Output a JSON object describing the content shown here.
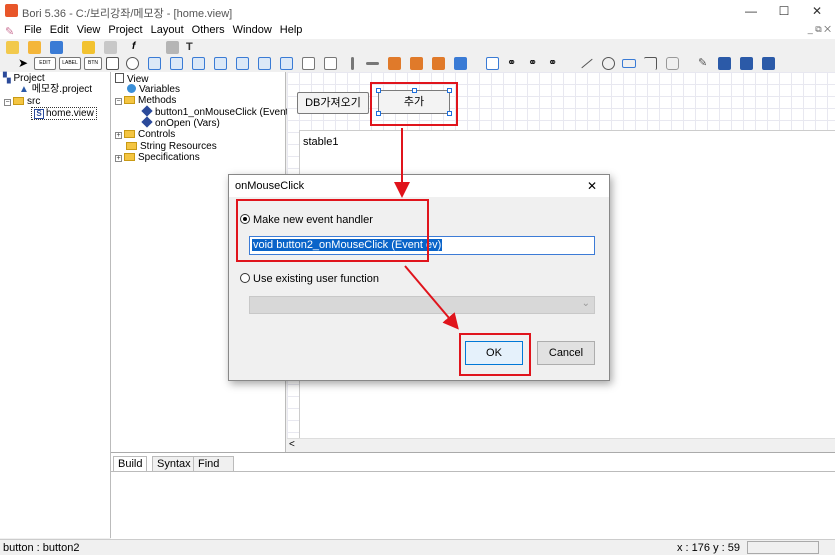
{
  "window": {
    "title": "Bori 5.36 - C:/보리강좌/메모장 - [home.view]",
    "minimize": "—",
    "maximize": "☐",
    "close": "✕"
  },
  "menu": [
    "File",
    "Edit",
    "View",
    "Project",
    "Layout",
    "Others",
    "Window",
    "Help"
  ],
  "mdi_controls": "_ ⧉ ✕",
  "toolbar2_labels": {
    "edit": "EDIT",
    "label": "LABEL",
    "btn": "BTN"
  },
  "project_tree": {
    "root": "Project",
    "project_file": "메모장.project",
    "src": "src",
    "file": "home.view"
  },
  "outline": {
    "view": "View",
    "variables": "Variables",
    "methods": "Methods",
    "method_items": [
      "button1_onMouseClick (Event)",
      "onOpen (Vars)"
    ],
    "controls": "Controls",
    "string_resources": "String Resources",
    "specifications": "Specifications"
  },
  "designer": {
    "db_button": "DB가져오기",
    "add_button": "추가",
    "table_label": "stable1",
    "scroll_left": "<"
  },
  "bottom_tabs": [
    "Build",
    "Syntax",
    "Find"
  ],
  "status": {
    "left": "button : button2",
    "coords": "x : 176  y : 59"
  },
  "dialog": {
    "title": "onMouseClick",
    "close": "✕",
    "option_new": "Make new event handler",
    "handler_value": "void button2_onMouseClick (Event ev)",
    "option_existing": "Use existing user function",
    "select_arrow": "⌄",
    "ok": "OK",
    "cancel": "Cancel"
  },
  "colors": {
    "highlight": "#e0141c",
    "accent": "#0078d7"
  }
}
